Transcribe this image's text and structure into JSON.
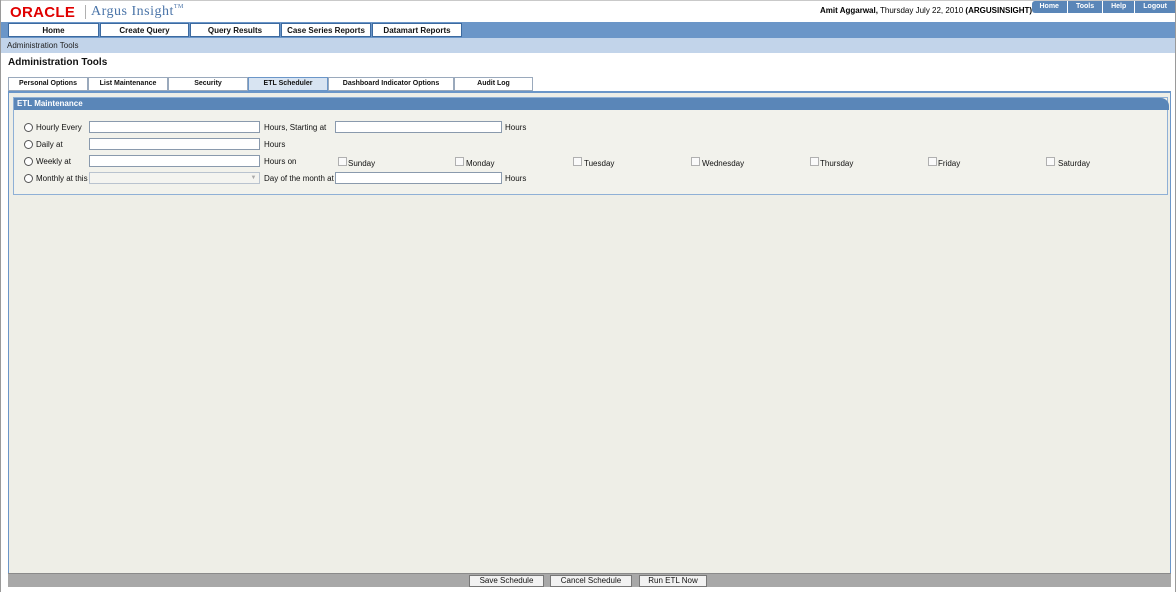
{
  "brand": {
    "oracle": "ORACLE",
    "product": "Argus Insight",
    "tm": "TM"
  },
  "user": {
    "name": "Amit Aggarwal,",
    "date": "Thursday July 22, 2010",
    "db": "(ARGUSINSIGHT)"
  },
  "top_links": [
    "Home",
    "Tools",
    "Help",
    "Logout"
  ],
  "nav": [
    "Home",
    "Create Query",
    "Query Results",
    "Case Series Reports",
    "Datamart Reports"
  ],
  "breadcrumb": "Administration Tools",
  "page_title": "Administration Tools",
  "tabs": [
    "Personal Options",
    "List Maintenance",
    "Security",
    "ETL Scheduler",
    "Dashboard Indicator Options",
    "Audit Log"
  ],
  "active_tab": "ETL Scheduler",
  "section": {
    "title": "ETL Maintenance",
    "hourly": {
      "label": "Hourly Every",
      "mid": "Hours, Starting at",
      "end": "Hours",
      "value": "",
      "start_value": ""
    },
    "daily": {
      "label": "Daily at",
      "end": "Hours",
      "value": ""
    },
    "weekly": {
      "label": "Weekly at",
      "mid": "Hours on",
      "value": "",
      "days": [
        "Sunday",
        "Monday",
        "Tuesday",
        "Wednesday",
        "Thursday",
        "Friday",
        "Saturday"
      ]
    },
    "monthly": {
      "label": "Monthly at this",
      "mid": "Day of the month at",
      "end": "Hours",
      "day_value": "",
      "value": ""
    }
  },
  "buttons": {
    "save": "Save Schedule",
    "cancel": "Cancel Schedule",
    "run": "Run ETL Now"
  },
  "colors": {
    "nav_blue": "#6b96c8",
    "crumb_blue": "#c2d4ea",
    "section_head": "#5a86b8",
    "panel_bg": "#eeeee7",
    "oracle_red": "#e00000"
  }
}
